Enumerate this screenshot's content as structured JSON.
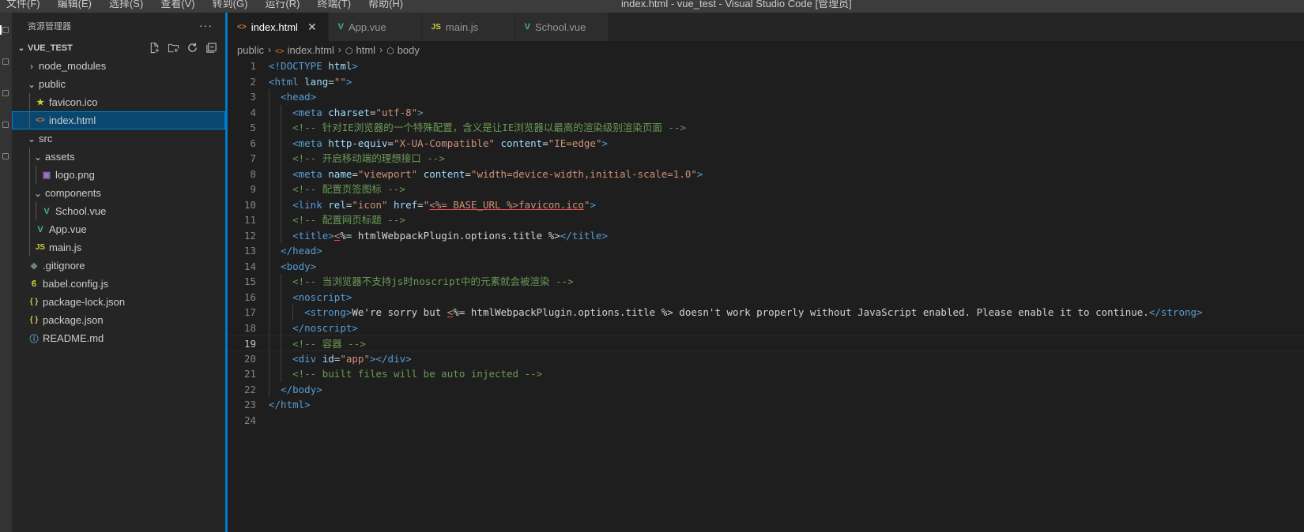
{
  "menu": [
    "文件(F)",
    "编辑(E)",
    "选择(S)",
    "查看(V)",
    "转到(G)",
    "运行(R)",
    "终端(T)",
    "帮助(H)"
  ],
  "window_title": "index.html - vue_test - Visual Studio Code [管理员]",
  "sidebar": {
    "header": "资源管理器",
    "more": "···",
    "project": "VUE_TEST",
    "tree": [
      {
        "label": "node_modules",
        "depth": 0,
        "type": "folder",
        "open": false
      },
      {
        "label": "public",
        "depth": 0,
        "type": "folder",
        "open": true
      },
      {
        "label": "favicon.ico",
        "depth": 1,
        "type": "ico"
      },
      {
        "label": "index.html",
        "depth": 1,
        "type": "html",
        "selected": true
      },
      {
        "label": "src",
        "depth": 0,
        "type": "folder",
        "open": true
      },
      {
        "label": "assets",
        "depth": 1,
        "type": "folder",
        "open": true
      },
      {
        "label": "logo.png",
        "depth": 2,
        "type": "png"
      },
      {
        "label": "components",
        "depth": 1,
        "type": "folder",
        "open": true
      },
      {
        "label": "School.vue",
        "depth": 2,
        "type": "vue"
      },
      {
        "label": "App.vue",
        "depth": 1,
        "type": "vue"
      },
      {
        "label": "main.js",
        "depth": 1,
        "type": "js"
      },
      {
        "label": ".gitignore",
        "depth": 0,
        "type": "git"
      },
      {
        "label": "babel.config.js",
        "depth": 0,
        "type": "babel"
      },
      {
        "label": "package-lock.json",
        "depth": 0,
        "type": "json"
      },
      {
        "label": "package.json",
        "depth": 0,
        "type": "json"
      },
      {
        "label": "README.md",
        "depth": 0,
        "type": "info"
      }
    ]
  },
  "tabs": [
    {
      "label": "index.html",
      "type": "html",
      "active": true
    },
    {
      "label": "App.vue",
      "type": "vue"
    },
    {
      "label": "main.js",
      "type": "js"
    },
    {
      "label": "School.vue",
      "type": "vue"
    }
  ],
  "breadcrumb": [
    "public",
    "index.html",
    "html",
    "body"
  ],
  "current_line": 19,
  "code_lines": [
    [
      [
        "tag",
        "<!DOCTYPE "
      ],
      [
        "attr",
        "html"
      ],
      [
        "tag",
        ">"
      ]
    ],
    [
      [
        "tag",
        "<html "
      ],
      [
        "attr",
        "lang"
      ],
      [
        "txt",
        "="
      ],
      [
        "str",
        "\"\""
      ],
      [
        "tag",
        ">"
      ]
    ],
    [
      [
        "ws",
        "  "
      ],
      [
        "tag",
        "<head>"
      ]
    ],
    [
      [
        "ws",
        "    "
      ],
      [
        "tag",
        "<meta "
      ],
      [
        "attr",
        "charset"
      ],
      [
        "txt",
        "="
      ],
      [
        "str",
        "\"utf-8\""
      ],
      [
        "tag",
        ">"
      ]
    ],
    [
      [
        "ws",
        "    "
      ],
      [
        "comment",
        "<!-- 针对IE浏览器的一个特殊配置，含义是让IE浏览器以最高的渲染级别渲染页面 -->"
      ]
    ],
    [
      [
        "ws",
        "    "
      ],
      [
        "tag",
        "<meta "
      ],
      [
        "attr",
        "http-equiv"
      ],
      [
        "txt",
        "="
      ],
      [
        "str",
        "\"X-UA-Compatible\""
      ],
      [
        "attr",
        " content"
      ],
      [
        "txt",
        "="
      ],
      [
        "str",
        "\"IE=edge\""
      ],
      [
        "tag",
        ">"
      ]
    ],
    [
      [
        "ws",
        "    "
      ],
      [
        "comment",
        "<!-- 开启移动端的理想接口 -->"
      ]
    ],
    [
      [
        "ws",
        "    "
      ],
      [
        "tag",
        "<meta "
      ],
      [
        "attr",
        "name"
      ],
      [
        "txt",
        "="
      ],
      [
        "str",
        "\"viewport\""
      ],
      [
        "attr",
        " content"
      ],
      [
        "txt",
        "="
      ],
      [
        "str",
        "\"width=device-width,initial-scale=1.0\""
      ],
      [
        "tag",
        ">"
      ]
    ],
    [
      [
        "ws",
        "    "
      ],
      [
        "comment",
        "<!-- 配置页签图标 -->"
      ]
    ],
    [
      [
        "ws",
        "    "
      ],
      [
        "tag",
        "<link "
      ],
      [
        "attr",
        "rel"
      ],
      [
        "txt",
        "="
      ],
      [
        "str",
        "\"icon\""
      ],
      [
        "attr",
        " href"
      ],
      [
        "txt",
        "="
      ],
      [
        "str",
        "\""
      ],
      [
        "warn",
        "<%= BASE_URL %>favicon.ico"
      ],
      [
        "str",
        "\""
      ],
      [
        "tag",
        ">"
      ]
    ],
    [
      [
        "ws",
        "    "
      ],
      [
        "comment",
        "<!-- 配置网页标题 -->"
      ]
    ],
    [
      [
        "ws",
        "    "
      ],
      [
        "tag",
        "<title>"
      ],
      [
        "warn",
        "<"
      ],
      [
        "txt",
        "%= htmlWebpackPlugin.options.title %>"
      ],
      [
        "tag",
        "</title>"
      ]
    ],
    [
      [
        "ws",
        "  "
      ],
      [
        "tag",
        "</head>"
      ]
    ],
    [
      [
        "ws",
        "  "
      ],
      [
        "tag",
        "<body>"
      ]
    ],
    [
      [
        "ws",
        "    "
      ],
      [
        "comment",
        "<!-- 当浏览器不支持js时noscript中的元素就会被渲染 -->"
      ]
    ],
    [
      [
        "ws",
        "    "
      ],
      [
        "tag",
        "<noscript>"
      ]
    ],
    [
      [
        "ws",
        "      "
      ],
      [
        "tag",
        "<strong>"
      ],
      [
        "txt",
        "We're sorry but "
      ],
      [
        "warn",
        "<"
      ],
      [
        "txt",
        "%= htmlWebpackPlugin.options.title %> doesn't work properly without JavaScript enabled. Please enable it to continue."
      ],
      [
        "tag",
        "</strong>"
      ]
    ],
    [
      [
        "ws",
        "    "
      ],
      [
        "tag",
        "</noscript>"
      ]
    ],
    [
      [
        "ws",
        "    "
      ],
      [
        "comment",
        "<!-- 容器 -->"
      ]
    ],
    [
      [
        "ws",
        "    "
      ],
      [
        "tag",
        "<div "
      ],
      [
        "attr",
        "id"
      ],
      [
        "txt",
        "="
      ],
      [
        "str",
        "\"app\""
      ],
      [
        "tag",
        "></div>"
      ]
    ],
    [
      [
        "ws",
        "    "
      ],
      [
        "comment",
        "<!-- built files will be auto injected -->"
      ]
    ],
    [
      [
        "ws",
        "  "
      ],
      [
        "tag",
        "</body>"
      ]
    ],
    [
      [
        "tag",
        "</html>"
      ]
    ],
    []
  ],
  "colors": {
    "accent": "#007acc",
    "selection": "#094771",
    "vue": "#41b883",
    "js": "#cbcb41",
    "html": "#e37933",
    "json": "#cbcb41",
    "info": "#519aba"
  }
}
